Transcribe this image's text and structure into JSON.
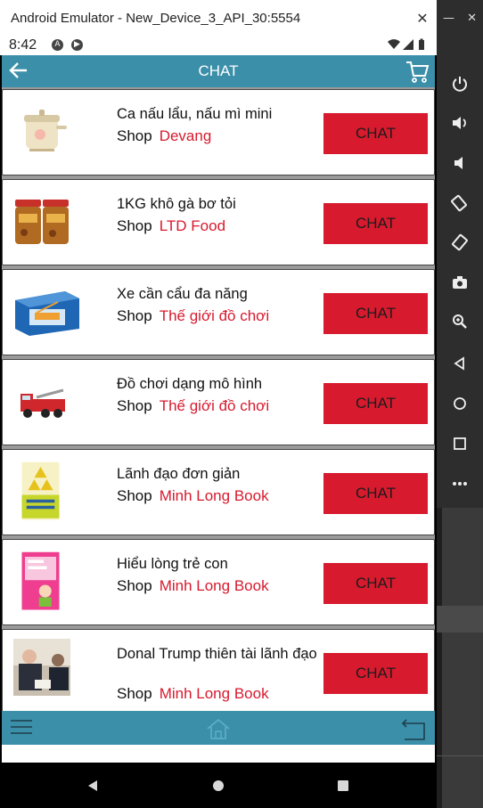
{
  "window": {
    "title": "Android Emulator - New_Device_3_API_30:5554"
  },
  "status_bar": {
    "time": "8:42"
  },
  "app_bar": {
    "title": "CHAT"
  },
  "items": [
    {
      "name": "Ca nấu lẩu, nấu mì mini",
      "shop_label": "Shop",
      "shop_name": "Devang",
      "button": "CHAT",
      "thumb_icon": "cooker-image"
    },
    {
      "name": "1KG khô gà bơ tỏi",
      "shop_label": "Shop",
      "shop_name": "LTD Food",
      "button": "CHAT",
      "thumb_icon": "jars-image"
    },
    {
      "name": "Xe cần cẩu đa năng",
      "shop_label": "Shop",
      "shop_name": "Thế giới đồ chơi",
      "button": "CHAT",
      "thumb_icon": "toy-box-image"
    },
    {
      "name": "Đồ chơi dạng mô hình",
      "shop_label": "Shop",
      "shop_name": "Thế giới đồ chơi",
      "button": "CHAT",
      "thumb_icon": "fire-truck-image"
    },
    {
      "name": "Lãnh đạo đơn giản",
      "shop_label": "Shop",
      "shop_name": "Minh Long Book",
      "button": "CHAT",
      "thumb_icon": "book-cover-image"
    },
    {
      "name": "Hiểu lòng trẻ con",
      "shop_label": "Shop",
      "shop_name": "Minh Long Book",
      "button": "CHAT",
      "thumb_icon": "book-cover-image"
    },
    {
      "name": "Donal Trump thiên tài lãnh đạo",
      "shop_label": "Shop",
      "shop_name": "Minh Long Book",
      "button": "CHAT",
      "thumb_icon": "photo-image"
    }
  ],
  "colors": {
    "accent": "#3b8fa9",
    "button": "#d71a2e",
    "shop_name": "#d71a2e"
  }
}
